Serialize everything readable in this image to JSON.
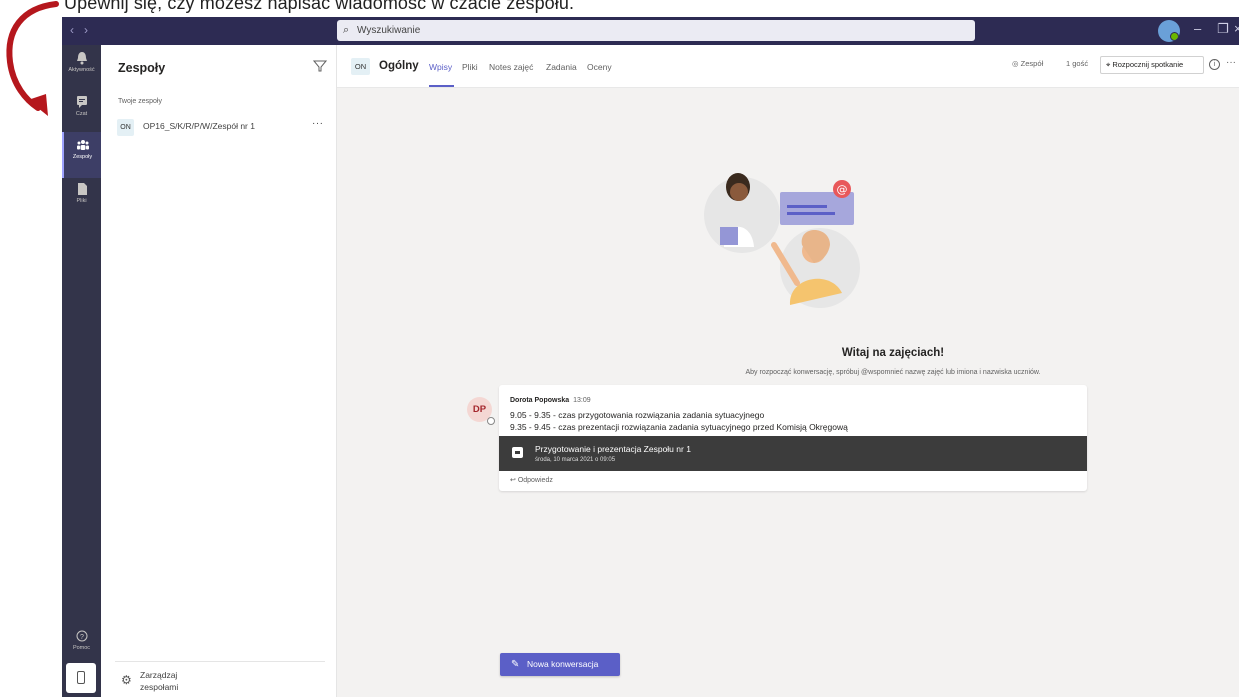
{
  "instruction": "Upewnij się, czy możesz napisać wiadomość w czacie zespołu.",
  "titlebar": {
    "back_icon": "chevron-left-icon",
    "forward_icon": "chevron-right-icon",
    "search_placeholder": "Wyszukiwanie"
  },
  "rail": {
    "items": [
      {
        "label": "Aktywność",
        "icon": "bell-icon"
      },
      {
        "label": "Czat",
        "icon": "chat-icon"
      },
      {
        "label": "Zespoły",
        "icon": "teams-icon"
      },
      {
        "label": "Pliki",
        "icon": "file-icon"
      },
      {
        "label": "Pomoc",
        "icon": "help-icon"
      }
    ]
  },
  "sidebar": {
    "title": "Zespoły",
    "section": "Twoje zespoły",
    "team": {
      "badge": "ON",
      "name": "OP16_S/K/R/P/W/Zespół nr 1",
      "more": "···"
    },
    "manage_label": "Zarządzaj zespołami"
  },
  "channel": {
    "badge": "ON",
    "name": "Ogólny",
    "tabs": [
      "Wpisy",
      "Pliki",
      "Notes zajęć",
      "Zadania",
      "Oceny"
    ],
    "active_tab": "Wpisy",
    "team_label": "Zespół",
    "guests": "1 gość",
    "meet_button": "Rozpocznij spotkanie"
  },
  "welcome": {
    "title": "Witaj na zajęciach!",
    "subtitle": "Aby rozpocząć konwersację, spróbuj @wspomnieć nazwę zajęć lub imiona i nazwiska uczniów."
  },
  "message": {
    "avatar_initials": "DP",
    "author": "Dorota Popowska",
    "time": "13:09",
    "line1": "9.05 - 9.35 - czas przygotowania rozwiązania zadania sytuacyjnego",
    "line2": "9.35 - 9.45 - czas prezentacji rozwiązania zadania sytuacyjnego przed Komisją Okręgową",
    "meeting_title": "Przygotowanie i prezentacja Zespołu nr 1",
    "meeting_date": "środa, 10 marca 2021 o 09:05",
    "reply_label": "Odpowiedz"
  },
  "new_conversation_label": "Nowa konwersacja",
  "colors": {
    "accent": "#5b5fc7",
    "rail": "#33344a",
    "titlebar": "#2d2b53",
    "arrow": "#b5171d"
  }
}
